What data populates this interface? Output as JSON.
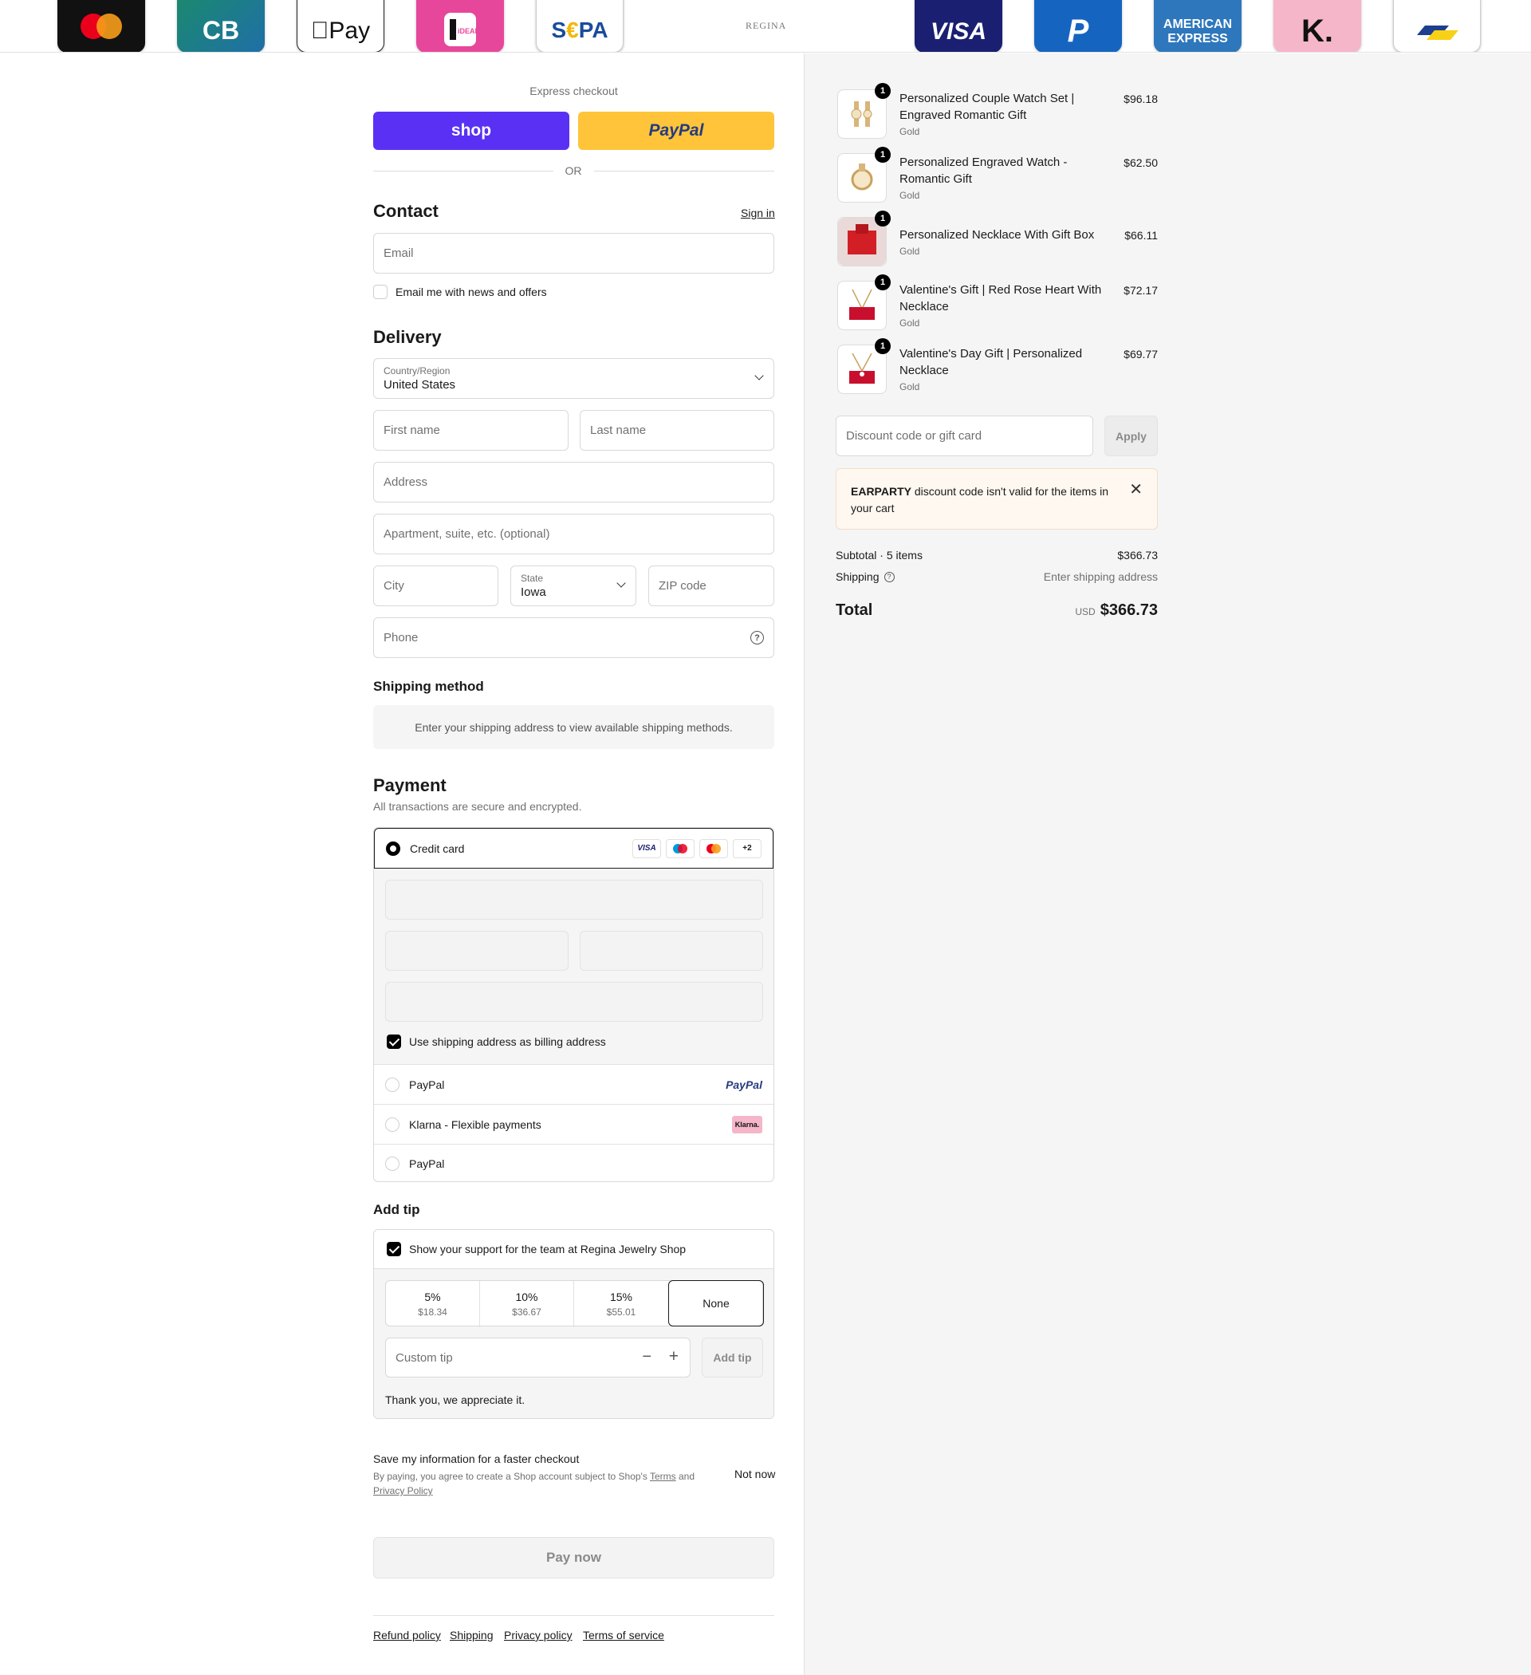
{
  "header": {
    "brand": "REGINA",
    "payment_logos": [
      "Mastercard",
      "CB",
      "Apple Pay",
      "iDEAL",
      "SEPA",
      "VISA",
      "PayPal",
      "American Express",
      "Klarna",
      "Bancontact"
    ]
  },
  "express": {
    "label": "Express checkout",
    "shop_label": "shop",
    "paypal_label": "PayPal",
    "or_label": "OR"
  },
  "contact": {
    "title": "Contact",
    "sign_in": "Sign in",
    "email_placeholder": "Email",
    "newsletter_label": "Email me with news and offers"
  },
  "delivery": {
    "title": "Delivery",
    "country_label": "Country/Region",
    "country_value": "United States",
    "first_name_placeholder": "First name",
    "last_name_placeholder": "Last name",
    "address_placeholder": "Address",
    "apartment_placeholder": "Apartment, suite, etc. (optional)",
    "city_placeholder": "City",
    "state_label": "State",
    "state_value": "Iowa",
    "zip_placeholder": "ZIP code",
    "phone_placeholder": "Phone"
  },
  "shipping_method": {
    "title": "Shipping method",
    "notice": "Enter your shipping address to view available shipping methods."
  },
  "payment": {
    "title": "Payment",
    "subtitle": "All transactions are secure and encrypted.",
    "credit_card_label": "Credit card",
    "card_brands": [
      "VISA",
      "Maestro",
      "Mastercard"
    ],
    "more_brands": "+2",
    "billing_same_label": "Use shipping address as billing address",
    "paypal_label": "PayPal",
    "paypal_logo": "PayPal",
    "klarna_label": "Klarna - Flexible payments",
    "klarna_logo": "Klarna.",
    "paypal2_label": "PayPal"
  },
  "tip": {
    "title": "Add tip",
    "support_label": "Show your support for the team at Regina Jewelry Shop",
    "options": [
      {
        "pct": "5%",
        "amt": "$18.34"
      },
      {
        "pct": "10%",
        "amt": "$36.67"
      },
      {
        "pct": "15%",
        "amt": "$55.01"
      },
      {
        "pct": "None",
        "amt": ""
      }
    ],
    "custom_placeholder": "Custom tip",
    "add_tip_label": "Add tip",
    "thanks": "Thank you, we appreciate it."
  },
  "save_info": {
    "title": "Save my information for a faster checkout",
    "terms_prefix": "By paying, you agree to create a Shop account subject to Shop's ",
    "terms_link": "Terms",
    "terms_and": " and",
    "privacy_link": "Privacy Policy",
    "not_now": "Not now"
  },
  "pay_now": "Pay now",
  "footer": {
    "links": [
      "Refund policy",
      "Shipping",
      "Privacy policy",
      "Terms of service"
    ]
  },
  "summary": {
    "items": [
      {
        "qty": "1",
        "name": "Personalized Couple Watch Set | Engraved Romantic Gift",
        "variant": "Gold",
        "price": "$96.18"
      },
      {
        "qty": "1",
        "name": "Personalized Engraved Watch - Romantic Gift",
        "variant": "Gold",
        "price": "$62.50"
      },
      {
        "qty": "1",
        "name": "Personalized Necklace With Gift Box",
        "variant": "Gold",
        "price": "$66.11"
      },
      {
        "qty": "1",
        "name": "Valentine's Gift | Red Rose Heart With Necklace",
        "variant": "Gold",
        "price": "$72.17"
      },
      {
        "qty": "1",
        "name": "Valentine's Day Gift | Personalized Necklace",
        "variant": "Gold",
        "price": "$69.77"
      }
    ],
    "discount_placeholder": "Discount code or gift card",
    "apply_label": "Apply",
    "discount_error_code": "EARPARTY",
    "discount_error_text": " discount code isn't valid for the items in your cart",
    "subtotal_label": "Subtotal · 5 items",
    "subtotal_value": "$366.73",
    "shipping_label": "Shipping",
    "shipping_value": "Enter shipping address",
    "total_label": "Total",
    "currency": "USD",
    "total_value": "$366.73"
  },
  "colors": {
    "shop_purple": "#5a31f4",
    "paypal_yellow": "#ffc439",
    "error_bg": "#fff8f0",
    "summary_bg": "#f5f5f5"
  }
}
